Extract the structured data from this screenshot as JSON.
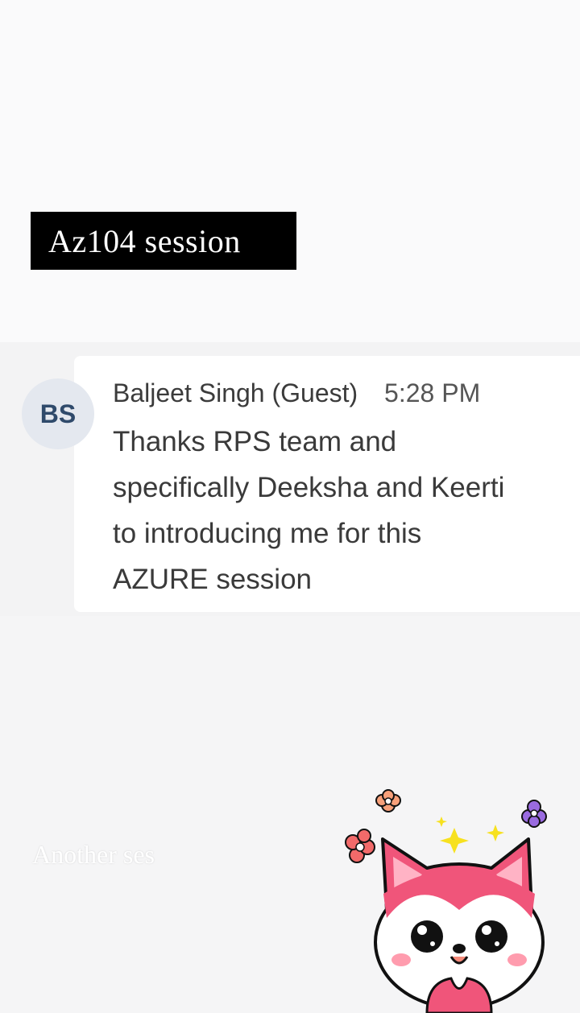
{
  "title": "Az104 session",
  "message": {
    "avatar_initials": "BS",
    "sender": "Baljeet Singh (Guest)",
    "time": "5:28 PM",
    "lines": [
      "Thanks RPS team and",
      "specifically Deeksha and Keerti",
      "to introducing me for this",
      "AZURE session"
    ]
  },
  "overlay_text": "Another ses",
  "sticker": {
    "name": "cat-sticker",
    "color": "#f0557a"
  }
}
